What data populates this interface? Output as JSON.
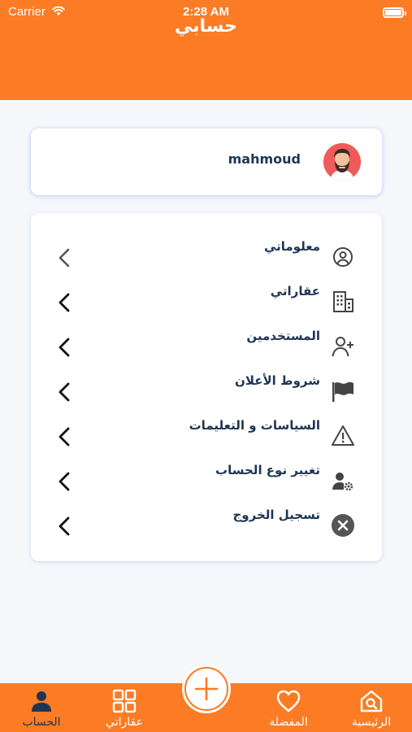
{
  "status_bar": {
    "carrier": "Carrier",
    "time": "2:28 AM"
  },
  "header": {
    "title": "حسابي"
  },
  "profile": {
    "name": "mahmoud"
  },
  "menu": {
    "items": [
      {
        "label": "معلوماتي",
        "icon": "user-circle-icon"
      },
      {
        "label": "عقاراتي",
        "icon": "building-icon"
      },
      {
        "label": "المستخدمين",
        "icon": "user-plus-icon"
      },
      {
        "label": "شروط الأعلان",
        "icon": "flag-icon"
      },
      {
        "label": "السياسات و التعليمات",
        "icon": "warning-icon"
      },
      {
        "label": "تغيير نوع الحساب",
        "icon": "user-gear-icon"
      },
      {
        "label": "تسجيل الخروج",
        "icon": "close-circle-icon"
      }
    ]
  },
  "bottom_nav": {
    "items": [
      {
        "label": "الحساب",
        "icon": "person-icon",
        "active": true
      },
      {
        "label": "عقاراتي",
        "icon": "grid-icon",
        "active": false
      },
      {
        "label": "المفضلة",
        "icon": "heart-icon",
        "active": false
      },
      {
        "label": "الرئيسية",
        "icon": "home-search-icon",
        "active": false
      }
    ],
    "add_icon": "plus-icon"
  },
  "colors": {
    "accent": "#fb7c24",
    "text": "#1f3554",
    "background": "#f5f7fb"
  }
}
